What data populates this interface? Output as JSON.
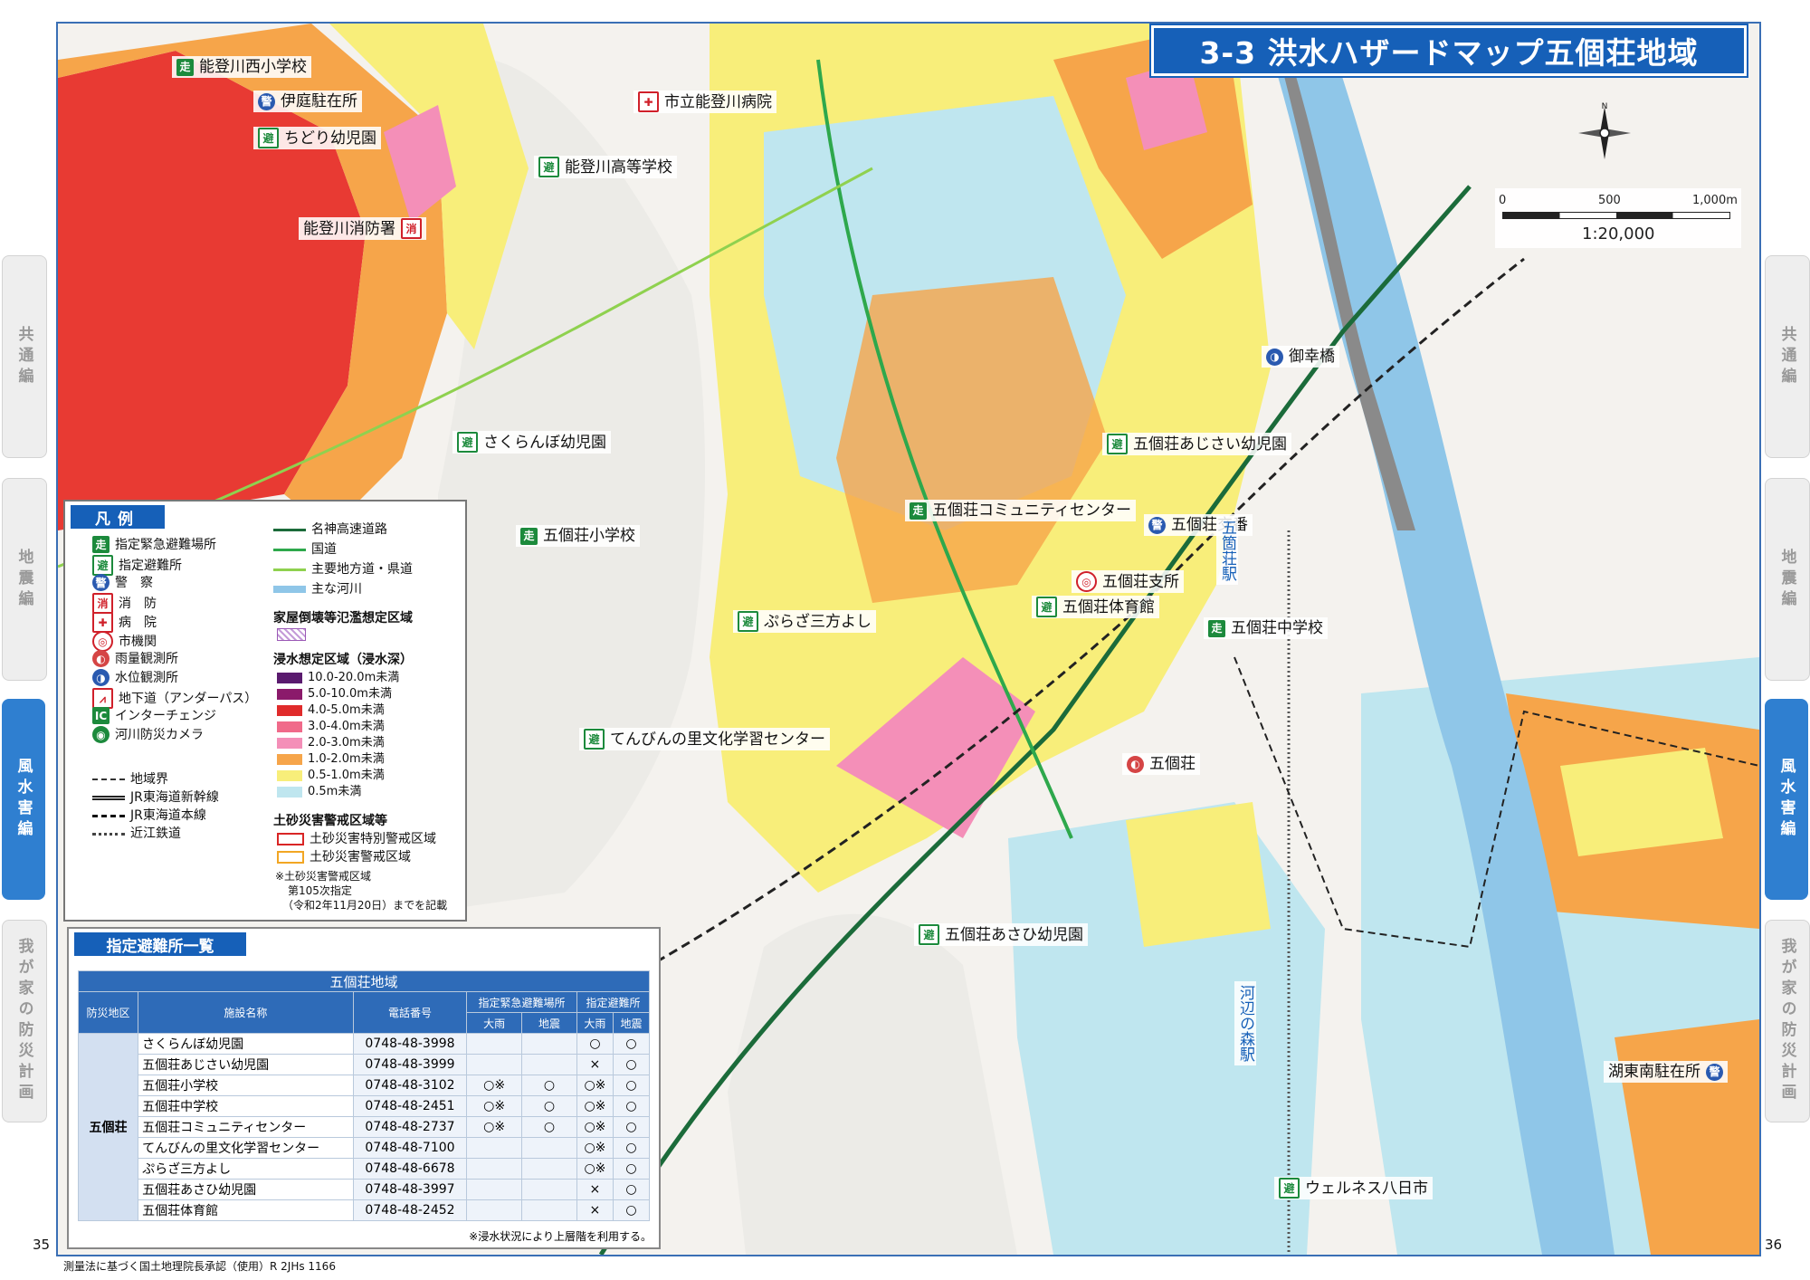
{
  "title": "3-3 洪水ハザードマップ五個荘地域",
  "page_left": "35",
  "page_right": "36",
  "footer_note": "測量法に基づく国土地理院長承認（使用）R 2JHs 1166",
  "side_tabs": [
    {
      "label": "共通編",
      "active": false
    },
    {
      "label": "地震編",
      "active": false
    },
    {
      "label": "風水害編",
      "active": true
    },
    {
      "label": "我が家の防災計画",
      "active": false
    }
  ],
  "compass_letter": "N",
  "scale": {
    "ticks": [
      "0",
      "500",
      "1,000m"
    ],
    "ratio": "1:20,000"
  },
  "map_labels": [
    {
      "icon": "emg",
      "text": "能登川西小学校"
    },
    {
      "icon": "police",
      "text": "伊庭駐在所"
    },
    {
      "icon": "shelter",
      "text": "ちどり幼児園"
    },
    {
      "icon": "fire",
      "text": "能登川消防署"
    },
    {
      "icon": "hosp",
      "text": "市立能登川病院"
    },
    {
      "icon": "shelter",
      "text": "能登川高等学校"
    },
    {
      "icon": "shelter",
      "text": "さくらんぼ幼児園"
    },
    {
      "icon": "shelter",
      "text": "五個荘あじさい幼児園"
    },
    {
      "icon": "emg",
      "text": "五個荘コミュニティセンター"
    },
    {
      "icon": "emg",
      "text": "五個荘小学校"
    },
    {
      "icon": "police",
      "text": "五個荘交番"
    },
    {
      "icon": "city",
      "text": "五個荘支所"
    },
    {
      "icon": "shelter",
      "text": "五個荘体育館"
    },
    {
      "icon": "emg",
      "text": "五個荘中学校"
    },
    {
      "icon": "shelter",
      "text": "ぷらざ三方よし"
    },
    {
      "icon": "shelter",
      "text": "てんびんの里文化学習センター"
    },
    {
      "icon": "rain",
      "text": "五個荘"
    },
    {
      "icon": "water",
      "text": "御幸橋"
    },
    {
      "icon": "shelter",
      "text": "五個荘あさひ幼児園"
    },
    {
      "icon": "police",
      "text": "湖東南駐在所"
    },
    {
      "icon": "shelter",
      "text": "ウェルネス八日市"
    }
  ],
  "station_labels": [
    "五箇荘駅",
    "河辺の森駅"
  ],
  "legend": {
    "title": "凡例",
    "facilities": [
      {
        "icon": "emg",
        "label": "指定緊急避難場所"
      },
      {
        "icon": "shelter",
        "label": "指定避難所"
      },
      {
        "icon": "police",
        "label": "警　察"
      },
      {
        "icon": "fire",
        "label": "消　防"
      },
      {
        "icon": "hosp",
        "label": "病　院"
      },
      {
        "icon": "city",
        "label": "市機関"
      },
      {
        "icon": "rain",
        "label": "雨量観測所"
      },
      {
        "icon": "water",
        "label": "水位観測所"
      },
      {
        "icon": "under",
        "label": "地下道（アンダーパス）"
      },
      {
        "icon": "ic-ch",
        "label": "インターチェンジ"
      },
      {
        "icon": "cam",
        "label": "河川防災カメラ"
      }
    ],
    "lines": [
      {
        "style": "boundary",
        "label": "地域界"
      },
      {
        "style": "shinkansen",
        "label": "JR東海道新幹線"
      },
      {
        "style": "jr",
        "label": "JR東海道本線"
      },
      {
        "style": "ohmi",
        "label": "近江鉄道"
      }
    ],
    "roads": [
      {
        "color": "#1b6b3a",
        "label": "名神高速道路"
      },
      {
        "color": "#2ea84c",
        "label": "国道"
      },
      {
        "color": "#8fd14f",
        "label": "主要地方道・県道"
      },
      {
        "color": "#8fc6e8",
        "label": "主な河川"
      }
    ],
    "collapse_title": "家屋倒壊等氾濫想定区域",
    "flood_title": "浸水想定区域（浸水深）",
    "flood_depths": [
      {
        "color": "#5a1a6e",
        "label": "10.0-20.0m未満"
      },
      {
        "color": "#8b1a6b",
        "label": "5.0-10.0m未満"
      },
      {
        "color": "#e02b2b",
        "label": "4.0-5.0m未満"
      },
      {
        "color": "#f06a8a",
        "label": "3.0-4.0m未満"
      },
      {
        "color": "#f48fb8",
        "label": "2.0-3.0m未満"
      },
      {
        "color": "#f6a54a",
        "label": "1.0-2.0m未満"
      },
      {
        "color": "#f8ee7a",
        "label": "0.5-1.0m未満"
      },
      {
        "color": "#bfe6ef",
        "label": "0.5m未満"
      }
    ],
    "landslide_title": "土砂災害警戒区域等",
    "landslide": [
      {
        "color": "#d92525",
        "label": "土砂災害特別警戒区域"
      },
      {
        "color": "#f2a623",
        "label": "土砂災害警戒区域"
      }
    ],
    "notes": [
      "※土砂災害警戒区域",
      "第105次指定",
      "（令和2年11月20日）までを記載"
    ]
  },
  "shelter_list": {
    "title": "指定避難所一覧",
    "area_title": "五個荘地域",
    "headers": {
      "region": "防災地区",
      "facility": "施設名称",
      "phone": "電話番号",
      "emergency": "指定緊急避難場所",
      "shelter": "指定避難所",
      "rain": "大雨",
      "quake": "地震"
    },
    "region_name": "五個荘",
    "rows": [
      {
        "name": "さくらんぼ幼児園",
        "phone": "0748-48-3998",
        "e_rain": "",
        "e_quake": "",
        "s_rain": "○",
        "s_quake": "○"
      },
      {
        "name": "五個荘あじさい幼児園",
        "phone": "0748-48-3999",
        "e_rain": "",
        "e_quake": "",
        "s_rain": "×",
        "s_quake": "○"
      },
      {
        "name": "五個荘小学校",
        "phone": "0748-48-3102",
        "e_rain": "○※",
        "e_quake": "○",
        "s_rain": "○※",
        "s_quake": "○"
      },
      {
        "name": "五個荘中学校",
        "phone": "0748-48-2451",
        "e_rain": "○※",
        "e_quake": "○",
        "s_rain": "○※",
        "s_quake": "○"
      },
      {
        "name": "五個荘コミュニティセンター",
        "phone": "0748-48-2737",
        "e_rain": "○※",
        "e_quake": "○",
        "s_rain": "○※",
        "s_quake": "○"
      },
      {
        "name": "てんびんの里文化学習センター",
        "phone": "0748-48-7100",
        "e_rain": "",
        "e_quake": "",
        "s_rain": "○※",
        "s_quake": "○"
      },
      {
        "name": "ぷらざ三方よし",
        "phone": "0748-48-6678",
        "e_rain": "",
        "e_quake": "",
        "s_rain": "○※",
        "s_quake": "○"
      },
      {
        "name": "五個荘あさひ幼児園",
        "phone": "0748-48-3997",
        "e_rain": "",
        "e_quake": "",
        "s_rain": "×",
        "s_quake": "○"
      },
      {
        "name": "五個荘体育館",
        "phone": "0748-48-2452",
        "e_rain": "",
        "e_quake": "",
        "s_rain": "×",
        "s_quake": "○"
      }
    ],
    "note": "※浸水状況により上層階を利用する。"
  }
}
